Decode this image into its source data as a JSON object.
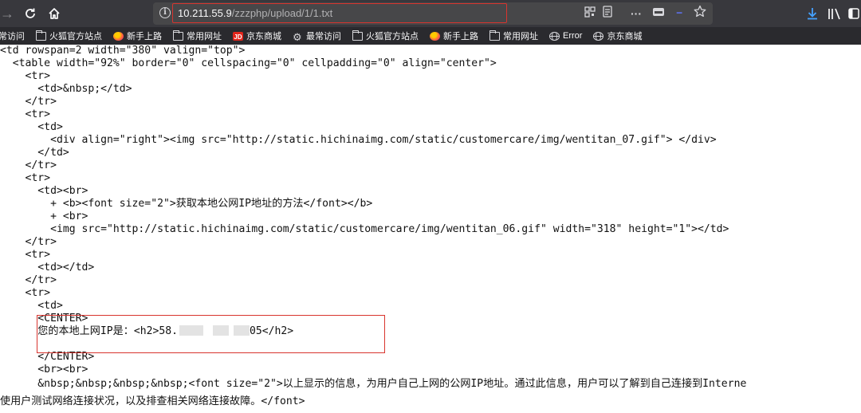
{
  "browser": {
    "url": {
      "host": "10.211.55.9",
      "path": "/zzzphp/upload/1/1.txt"
    },
    "toolbar_icons": [
      "back-icon",
      "reload-icon",
      "home-icon",
      "info-icon",
      "qr-code-icon",
      "reader-view-icon",
      "more-icon",
      "pocket-icon",
      "bookmark-star-icon",
      "download-icon",
      "library-icon",
      "sidebar-icon"
    ],
    "bookmarks": [
      {
        "icon": "folder-icon",
        "label": "常访问"
      },
      {
        "icon": "folder-icon",
        "label": "火狐官方站点"
      },
      {
        "icon": "firefox-icon",
        "label": "新手上路"
      },
      {
        "icon": "folder-icon",
        "label": "常用网址"
      },
      {
        "icon": "jd-icon",
        "label": "京东商城"
      },
      {
        "icon": "gear-icon",
        "label": "最常访问"
      },
      {
        "icon": "folder-icon",
        "label": "火狐官方站点"
      },
      {
        "icon": "firefox-icon",
        "label": "新手上路"
      },
      {
        "icon": "folder-icon",
        "label": "常用网址"
      },
      {
        "icon": "globe-icon",
        "label": "Error"
      },
      {
        "icon": "globe-icon",
        "label": "京东商城"
      }
    ]
  },
  "source_lines": [
    "<td rowspan=2 width=\"380\" valign=\"top\">",
    "  <table width=\"92%\" border=\"0\" cellspacing=\"0\" cellpadding=\"0\" align=\"center\">",
    "    <tr>",
    "      <td>&nbsp;</td>",
    "    </tr>",
    "    <tr>",
    "      <td>",
    "        <div align=\"right\"><img src=\"http://static.hichinaimg.com/static/customercare/img/wentitan_07.gif\"> </div>",
    "      </td>",
    "    </tr>",
    "    <tr>",
    "      <td><br>",
    "        + <b><font size=\"2\">获取本地公网IP地址的方法</font></b>",
    "        + <br>",
    "        <img src=\"http://static.hichinaimg.com/static/customercare/img/wentitan_06.gif\" width=\"318\" height=\"1\"></td>",
    "    </tr>",
    "    <tr>",
    "      <td></td>",
    "    </tr>",
    "    <tr>",
    "      <td>",
    "      <CENTER>",
    "      您的本地上网IP是：<h2>58.",
    "",
    "      </CENTER>",
    "      <br><br>",
    "      &nbsp;&nbsp;&nbsp;&nbsp;<font size=\"2\">以上显示的信息，为用户自己上网的公网IP地址。通过此信息，用户可以了解到自己连接到Interne",
    "使用户测试网络连接状况，以及排查相关网络连接故障。</font>"
  ],
  "ip_line_suffix": "05</h2>"
}
